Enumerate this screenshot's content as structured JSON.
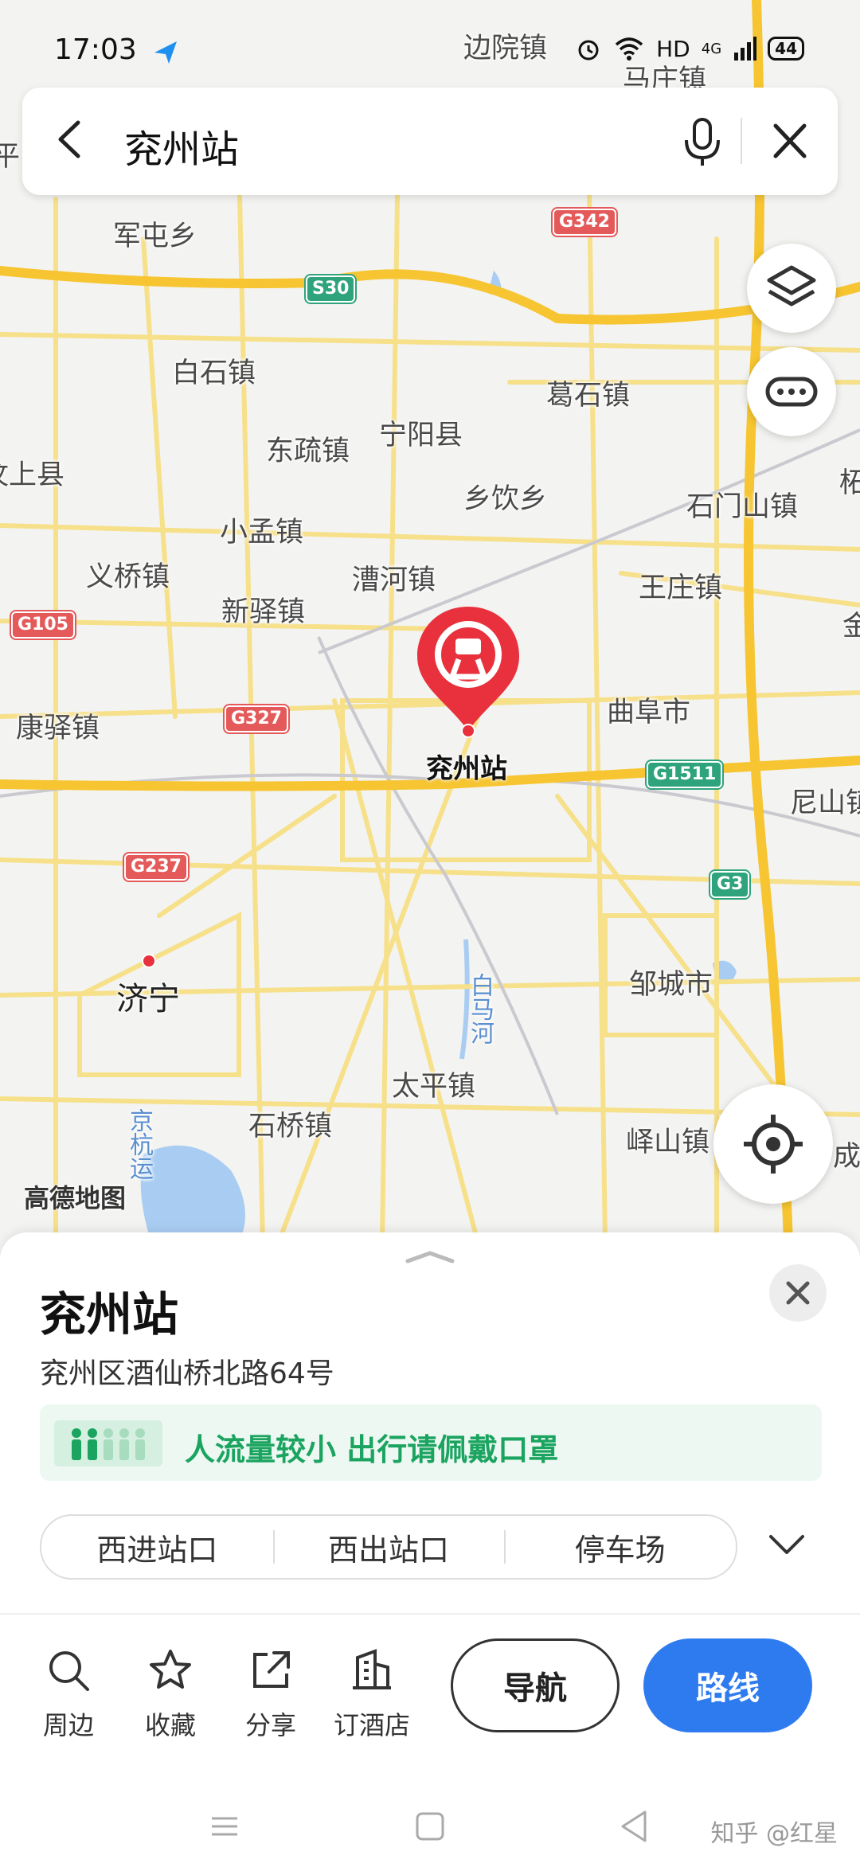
{
  "status_bar": {
    "time": "17:03",
    "network": "HD",
    "cell": "4G",
    "battery": "44"
  },
  "search": {
    "query": "兖州站"
  },
  "map": {
    "place_labels": [
      {
        "text": "边院镇"
      },
      {
        "text": "马庄镇"
      },
      {
        "text": "军屯乡"
      },
      {
        "text": "白石镇"
      },
      {
        "text": "葛石镇"
      },
      {
        "text": "宁阳县"
      },
      {
        "text": "东疏镇"
      },
      {
        "text": "汶上县"
      },
      {
        "text": "乡饮乡"
      },
      {
        "text": "石门山镇"
      },
      {
        "text": "小孟镇"
      },
      {
        "text": "义桥镇"
      },
      {
        "text": "漕河镇"
      },
      {
        "text": "王庄镇"
      },
      {
        "text": "新驿镇"
      },
      {
        "text": "康驿镇"
      },
      {
        "text": "曲阜市"
      },
      {
        "text": "尼山镇"
      },
      {
        "text": "济宁"
      },
      {
        "text": "邹城市"
      },
      {
        "text": "白马河"
      },
      {
        "text": "太平镇"
      },
      {
        "text": "石桥镇"
      },
      {
        "text": "峄山镇"
      },
      {
        "text": "京杭运"
      },
      {
        "text": "平"
      },
      {
        "text": "柘"
      },
      {
        "text": "金"
      },
      {
        "text": "成"
      }
    ],
    "road_shields": [
      {
        "text": "G342",
        "kind": "g"
      },
      {
        "text": "S30",
        "kind": "s"
      },
      {
        "text": "G105",
        "kind": "g"
      },
      {
        "text": "G327",
        "kind": "g"
      },
      {
        "text": "G1511",
        "kind": "s"
      },
      {
        "text": "G237",
        "kind": "g"
      },
      {
        "text": "G3",
        "kind": "s"
      }
    ],
    "marker_label": "兖州站",
    "watermark": "高德地图",
    "colors": {
      "road_major": "#f6c531",
      "road_minor": "#f7e08a",
      "marker": "#e8313d",
      "water": "#a9cdf2"
    }
  },
  "place": {
    "name": "兖州站",
    "address": "兖州区酒仙桥北路64号",
    "crowd_notice": "人流量较小 出行请佩戴口罩",
    "gates": [
      "西进站口",
      "西出站口",
      "停车场"
    ]
  },
  "actions": [
    {
      "label": "周边",
      "icon": "search-icon"
    },
    {
      "label": "收藏",
      "icon": "star-icon"
    },
    {
      "label": "分享",
      "icon": "share-icon"
    },
    {
      "label": "订酒店",
      "icon": "hotel-icon"
    }
  ],
  "buttons": {
    "navigate": "导航",
    "route": "路线",
    "accent": "#2e7bf0"
  },
  "credit": "知乎 @红星"
}
